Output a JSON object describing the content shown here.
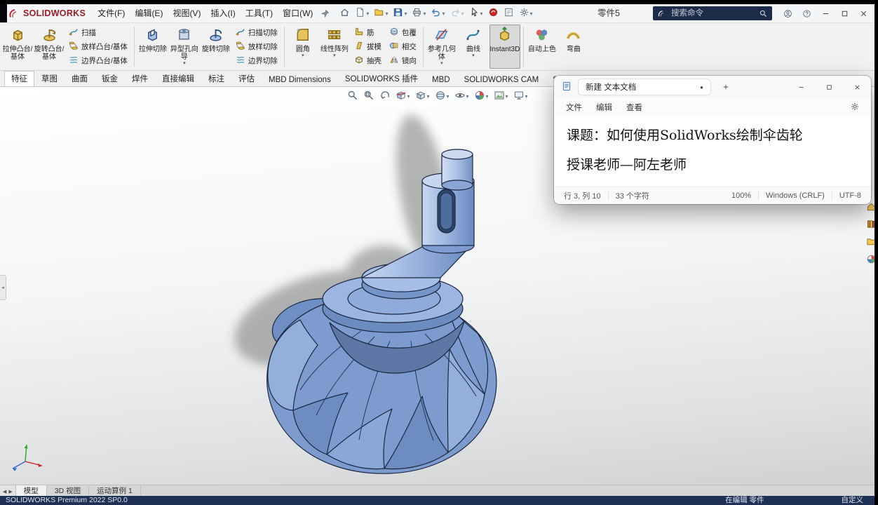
{
  "colors": {
    "status_navy": "#1e3054",
    "search_bg": "#1d2c49",
    "brand_red": "#9e1c24",
    "model_blue": "#7d9bce"
  },
  "titlebar": {
    "brand": "SOLIDWORKS",
    "menus": [
      "文件(F)",
      "编辑(E)",
      "视图(V)",
      "插入(I)",
      "工具(T)",
      "窗口(W)"
    ],
    "doc_title": "零件5",
    "search_placeholder": "搜索命令",
    "quick_tools": [
      {
        "name": "home-icon"
      },
      {
        "name": "new-document-icon",
        "caret": true
      },
      {
        "name": "open-icon",
        "caret": true
      },
      {
        "name": "save-icon",
        "caret": true
      },
      {
        "name": "print-icon",
        "caret": true
      },
      {
        "name": "undo-icon",
        "caret": true
      },
      {
        "name": "redo-icon",
        "caret": true,
        "disabled": true
      },
      {
        "name": "select-cursor-icon",
        "caret": true
      },
      {
        "name": "rebuild-icon"
      },
      {
        "name": "file-properties-icon"
      },
      {
        "name": "options-icon",
        "caret": true
      }
    ]
  },
  "ribbon": {
    "groups": [
      {
        "type": "big",
        "name": "extruded-boss",
        "icon": "extrude",
        "label": "拉伸凸台/基体"
      },
      {
        "type": "big",
        "name": "revolved-boss",
        "icon": "revolve",
        "label": "旋转凸台/基体"
      },
      {
        "type": "stack",
        "items": [
          {
            "name": "swept-boss",
            "icon": "sweep",
            "label": "扫描"
          },
          {
            "name": "lofted-boss",
            "icon": "loft",
            "label": "放样凸台/基体"
          },
          {
            "name": "boundary-boss",
            "icon": "boundary",
            "label": "边界凸台/基体"
          }
        ]
      },
      {
        "type": "sep"
      },
      {
        "type": "big",
        "name": "extruded-cut",
        "icon": "extrude-cut",
        "label": "拉伸切除"
      },
      {
        "type": "big",
        "name": "hole-wizard",
        "icon": "hole",
        "label": "异型孔向导",
        "caret": true
      },
      {
        "type": "big",
        "name": "revolved-cut",
        "icon": "revolve-cut",
        "label": "旋转切除"
      },
      {
        "type": "stack",
        "items": [
          {
            "name": "swept-cut",
            "icon": "sweep-cut",
            "label": "扫描切除"
          },
          {
            "name": "lofted-cut",
            "icon": "loft-cut",
            "label": "放样切除"
          },
          {
            "name": "boundary-cut",
            "icon": "boundary-cut",
            "label": "边界切除"
          }
        ]
      },
      {
        "type": "sep"
      },
      {
        "type": "big",
        "name": "fillet",
        "icon": "fillet",
        "label": "圆角",
        "caret": true
      },
      {
        "type": "big",
        "name": "linear-pattern",
        "icon": "pattern",
        "label": "线性阵列",
        "caret": true
      },
      {
        "type": "stack",
        "items": [
          {
            "name": "rib",
            "icon": "rib",
            "label": "筋"
          },
          {
            "name": "draft",
            "icon": "draft",
            "label": "拔模"
          },
          {
            "name": "shell",
            "icon": "shell",
            "label": "抽壳"
          }
        ]
      },
      {
        "type": "stack",
        "items": [
          {
            "name": "wrap",
            "icon": "wrap",
            "label": "包覆"
          },
          {
            "name": "intersect",
            "icon": "intersect",
            "label": "相交"
          },
          {
            "name": "mirror",
            "icon": "mirror",
            "label": "镜向"
          }
        ]
      },
      {
        "type": "sep"
      },
      {
        "type": "big",
        "name": "reference-geometry",
        "icon": "refgeo",
        "label": "参考几何体",
        "caret": true
      },
      {
        "type": "big",
        "name": "curves",
        "icon": "curve",
        "label": "曲线",
        "caret": true
      },
      {
        "type": "big",
        "name": "instant3d",
        "icon": "instant3d",
        "label": "Instant3D",
        "active": true
      },
      {
        "type": "sep"
      },
      {
        "type": "big",
        "name": "auto-shade",
        "icon": "paint",
        "label": "自动上色"
      },
      {
        "type": "big",
        "name": "flex",
        "icon": "flex",
        "label": "弯曲"
      }
    ]
  },
  "feature_tabs": [
    "特征",
    "草图",
    "曲面",
    "钣金",
    "焊件",
    "直接编辑",
    "标注",
    "评估",
    "MBD Dimensions",
    "SOLIDWORKS 插件",
    "MBD",
    "SOLIDWORKS CAM",
    "SOLIDWORKS C"
  ],
  "feature_tabs_active": 0,
  "viewport": {
    "headsup": [
      {
        "name": "zoom-to-fit-icon"
      },
      {
        "name": "zoom-to-area-icon"
      },
      {
        "name": "previous-view-icon"
      },
      {
        "name": "section-view-icon",
        "caret": true
      },
      {
        "name": "view-orientation-icon",
        "caret": true
      },
      {
        "name": "display-style-icon",
        "caret": true
      },
      {
        "name": "hide-show-items-icon",
        "caret": true
      },
      {
        "name": "edit-appearance-icon",
        "caret": true
      },
      {
        "name": "apply-scene-icon",
        "caret": true
      },
      {
        "name": "view-settings-icon",
        "caret": true
      }
    ]
  },
  "taskpane": [
    "solidworks-resources-icon",
    "design-library-icon",
    "file-explorer-icon",
    "appearances-icon"
  ],
  "notepad": {
    "tab_title": "新建 文本文档",
    "unsaved_indicator": "●",
    "menus": [
      "文件",
      "编辑",
      "查看"
    ],
    "lines": [
      "课题：如何使用SolidWorks绘制伞齿轮",
      "授课老师—阿左老师"
    ],
    "status": {
      "position": "行 3, 列 10",
      "chars": "33 个字符",
      "zoom": "100%",
      "eol": "Windows (CRLF)",
      "encoding": "UTF-8"
    }
  },
  "bottom": {
    "model_tabs": [
      "模型",
      "3D 视图",
      "运动算例 1"
    ],
    "active_index": 0
  },
  "statusbar": {
    "product": "SOLIDWORKS Premium 2022 SP0.0",
    "editing": "在编辑 零件",
    "customize": "自定义"
  }
}
